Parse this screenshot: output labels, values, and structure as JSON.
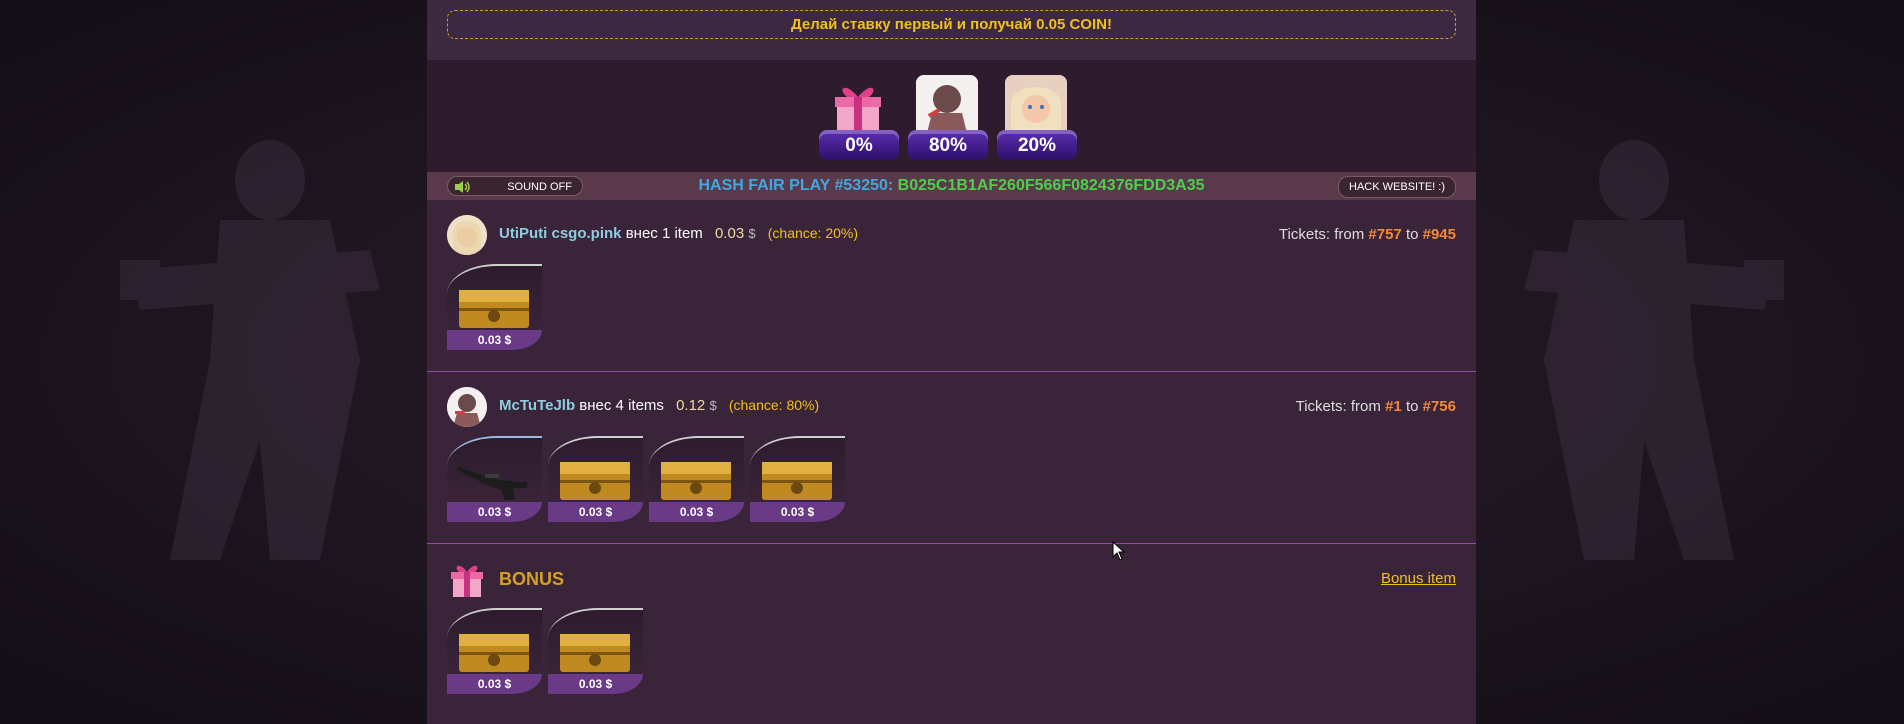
{
  "banner": {
    "text": "Делай ставку первый и получай 0.05 COIN!"
  },
  "chances": [
    {
      "icon": "gift-icon",
      "percent": "0%"
    },
    {
      "icon": "player-avatar-2",
      "percent": "80%"
    },
    {
      "icon": "player-avatar-1",
      "percent": "20%"
    }
  ],
  "hash_bar": {
    "sound_label": "SOUND OFF",
    "hash_label": "HASH FAIR PLAY #53250:",
    "hash_value": "B025C1B1AF260F566F0824376FDD3A35",
    "hack_label": "HACK WEBSITE! :)"
  },
  "bets": [
    {
      "player": "UtiPuti csgo.pink",
      "action": "внес 1 item",
      "amount": "0.03",
      "currency": "$",
      "chance": "(chance: 20%)",
      "tickets_prefix": "Tickets: from",
      "ticket_from": "#757",
      "tickets_to": "to",
      "ticket_to": "#945",
      "items": [
        {
          "type": "case",
          "price": "0.03 $"
        }
      ]
    },
    {
      "player": "McTuTeJlb",
      "action": "внес 4 items",
      "amount": "0.12",
      "currency": "$",
      "chance": "(chance: 80%)",
      "tickets_prefix": "Tickets: from",
      "ticket_from": "#1",
      "tickets_to": "to",
      "ticket_to": "#756",
      "items": [
        {
          "type": "rifle",
          "price": "0.03 $"
        },
        {
          "type": "case",
          "price": "0.03 $"
        },
        {
          "type": "case",
          "price": "0.03 $"
        },
        {
          "type": "case",
          "price": "0.03 $"
        }
      ]
    }
  ],
  "bonus": {
    "title": "BONUS",
    "link": "Bonus item",
    "items": [
      {
        "type": "case",
        "price": "0.03 $"
      },
      {
        "type": "case",
        "price": "0.03 $"
      }
    ]
  }
}
